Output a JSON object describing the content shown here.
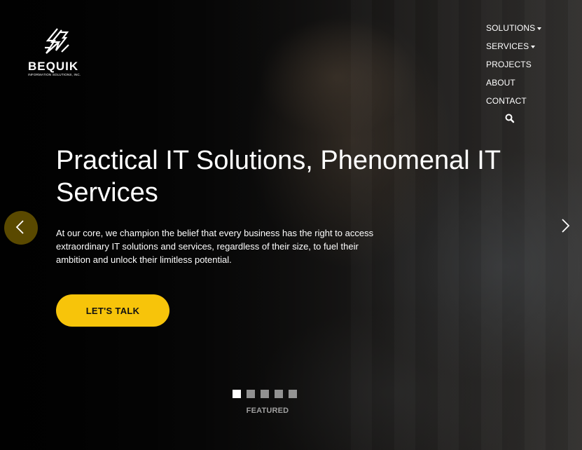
{
  "brand": {
    "name": "BEQUIK",
    "tagline": "INFORMATION SOLUTIONS, INC."
  },
  "nav": {
    "items": [
      {
        "label": "SOLUTIONS",
        "dropdown": true
      },
      {
        "label": "SERVICES",
        "dropdown": true
      },
      {
        "label": "PROJECTS",
        "dropdown": false
      },
      {
        "label": "ABOUT",
        "dropdown": false
      },
      {
        "label": "CONTACT",
        "dropdown": false
      }
    ],
    "search_icon": "search-icon"
  },
  "hero": {
    "headline": "Practical IT Solutions, Phenomenal IT Services",
    "subtext": "At our core, we champion the belief that every business has the right to access extraordinary IT solutions and services, regardless of their size, to fuel their ambition and unlock their limitless potential.",
    "cta_label": "LET'S TALK"
  },
  "carousel": {
    "slide_count": 5,
    "active_index": 0,
    "caption": "FEATURED",
    "prev_icon": "chevron-left-icon",
    "next_icon": "chevron-right-icon"
  },
  "colors": {
    "accent": "#f7c40a",
    "text": "#ffffff",
    "prev_button_bg": "#806800"
  }
}
